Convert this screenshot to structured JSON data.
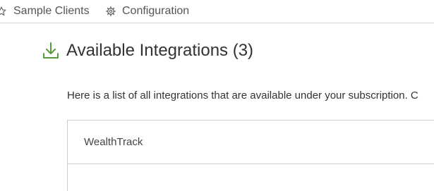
{
  "nav": {
    "items": [
      {
        "label": "Sample Clients",
        "icon": "star-outline-icon"
      },
      {
        "label": "Configuration",
        "icon": "gear-icon"
      }
    ]
  },
  "main": {
    "title": "Available Integrations (3)",
    "title_icon": "download-icon",
    "description": "Here is a list of all integrations that are available under your subscription. C",
    "integrations": [
      {
        "name": "WealthTrack"
      }
    ]
  },
  "colors": {
    "accent_green": "#5a9a3a",
    "border": "#cfcfcf",
    "text": "#333333"
  }
}
